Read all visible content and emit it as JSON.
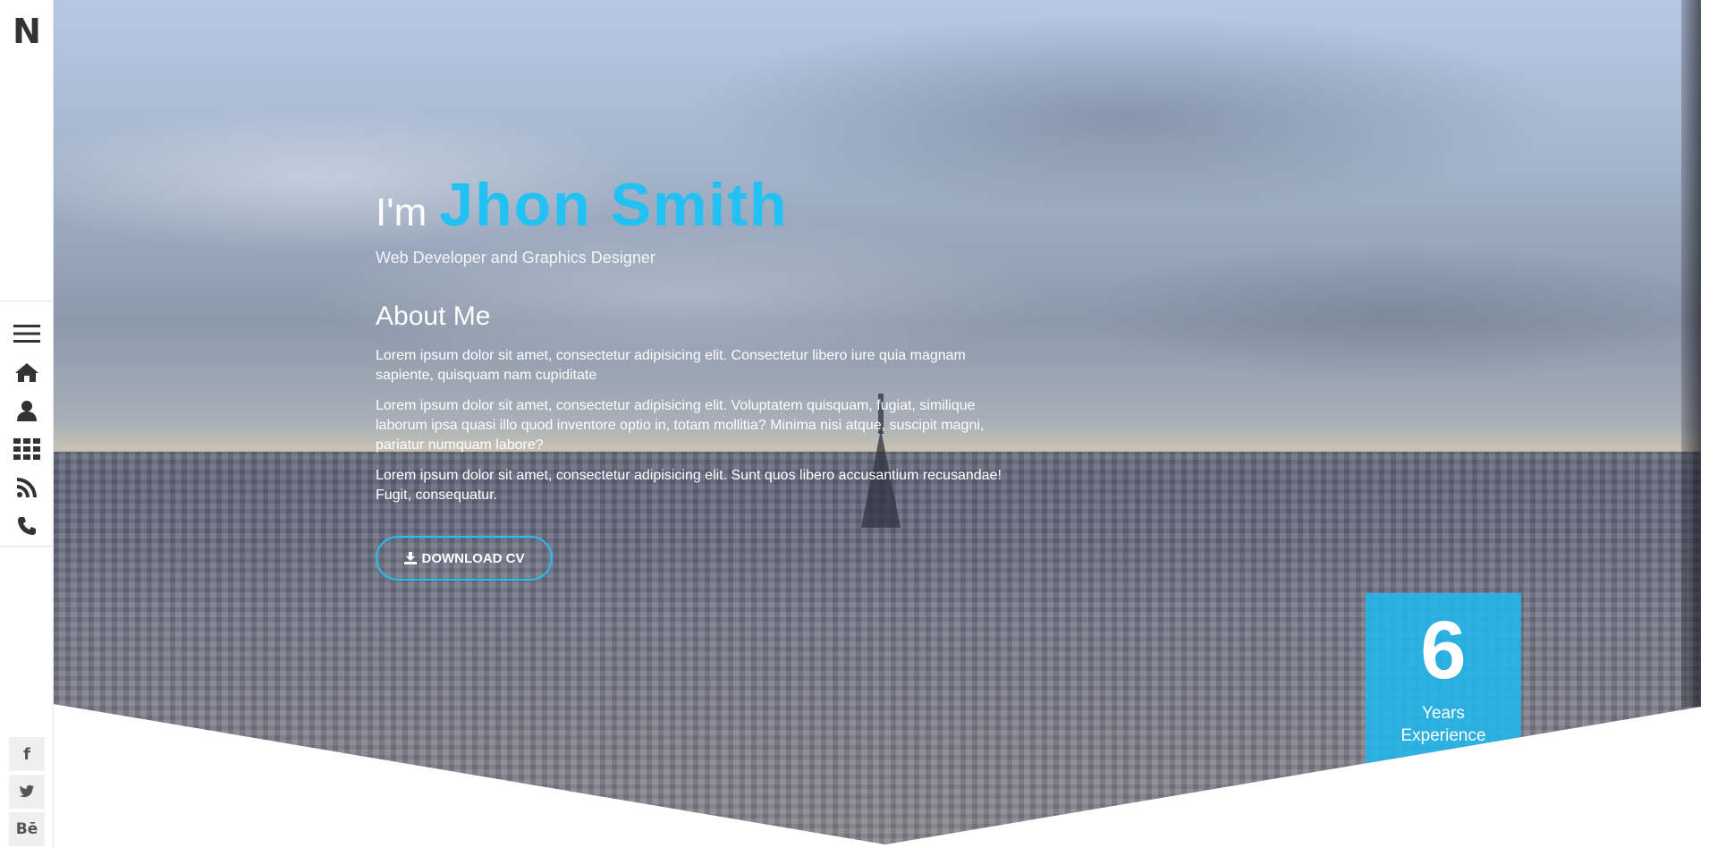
{
  "sidebar": {
    "logo": "N",
    "nav": [
      {
        "icon": "menu-icon"
      },
      {
        "icon": "home-icon"
      },
      {
        "icon": "user-icon"
      },
      {
        "icon": "grid-icon"
      },
      {
        "icon": "rss-icon"
      },
      {
        "icon": "phone-icon"
      }
    ],
    "social": [
      {
        "icon": "facebook-icon",
        "label": "f"
      },
      {
        "icon": "twitter-icon",
        "label": ""
      },
      {
        "icon": "behance-icon",
        "label": "Bē"
      }
    ]
  },
  "hero": {
    "greeting_prefix": "I'm",
    "name": "Jhon Smith",
    "subtitle": "Web Developer and Graphics Designer",
    "about_title": "About Me",
    "paragraphs": [
      "Lorem ipsum dolor sit amet, consectetur adipisicing elit. Consectetur libero iure quia magnam sapiente, quisquam nam cupiditate",
      "Lorem ipsum dolor sit amet, consectetur adipisicing elit. Voluptatem quisquam, fugiat, similique laborum ipsa quasi illo quod inventore optio in, totam mollitia? Minima nisi atque, suscipit magni, pariatur numquam labore?",
      "Lorem ipsum dolor sit amet, consectetur adipisicing elit. Sunt quos libero accusantium recusandae! Fugit, consequatur."
    ],
    "cv_button": "DOWNLOAD CV"
  },
  "experience": {
    "number": "6",
    "label_line1": "Years",
    "label_line2": "Experience"
  },
  "colors": {
    "accent": "#21c1f3",
    "experience_box": "#21b7ec"
  }
}
